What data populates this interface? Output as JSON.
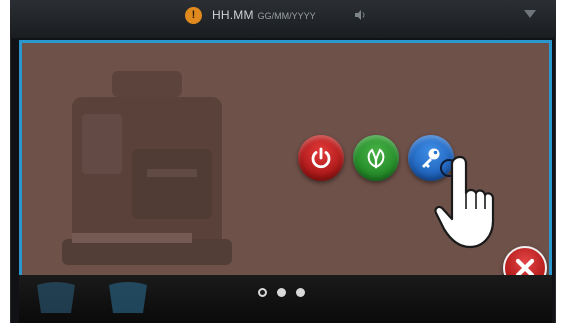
{
  "status_bar": {
    "time": "HH.MM",
    "date": "GG/MM/YYYY",
    "warning_icon": "warning-icon",
    "warning_color": "#e08a1e"
  },
  "overlay": {
    "background_color": "#6e5149",
    "border_color": "#2a97cf",
    "buttons": [
      {
        "name": "power",
        "icon": "power-icon",
        "color": "#c62222"
      },
      {
        "name": "eco",
        "icon": "leaf-icon",
        "color": "#2e9a30"
      },
      {
        "name": "key",
        "icon": "key-icon",
        "color": "#2a74cf"
      }
    ],
    "close_icon": "close-icon",
    "close_color": "#c62222"
  },
  "pagination": {
    "pages": 3,
    "current": 1
  }
}
